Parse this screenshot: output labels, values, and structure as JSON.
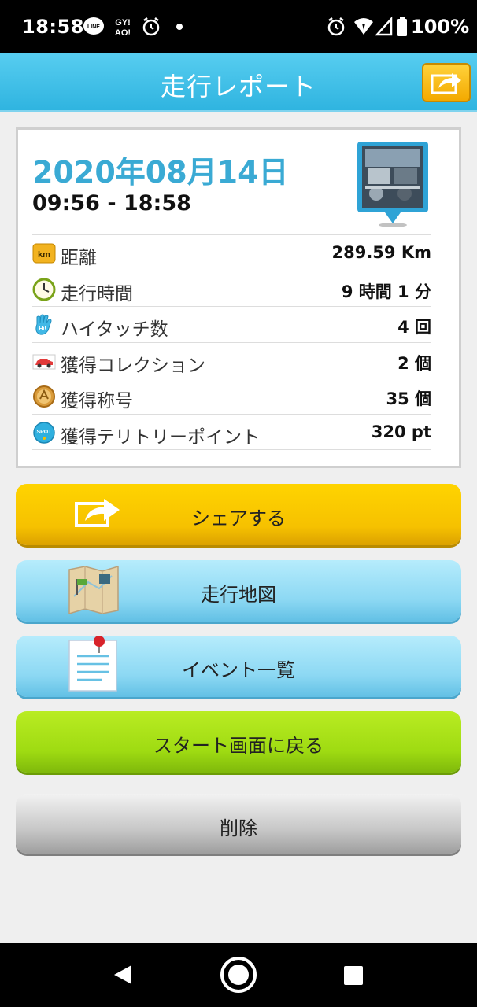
{
  "status_bar": {
    "time": "18:58",
    "battery": "100%",
    "icons": [
      "line-icon",
      "gyao-icon",
      "alarm-icon",
      "dot-icon",
      "alarm-icon",
      "wifi-icon",
      "signal-icon",
      "battery-icon"
    ]
  },
  "header": {
    "title": "走行レポート",
    "share_icon": "share-icon"
  },
  "report": {
    "date": "2020年08月14日",
    "time_range": "09:56 - 18:58",
    "stats": [
      {
        "icon": "km-icon",
        "label": "距離",
        "value": "289.59 Km"
      },
      {
        "icon": "clock-icon",
        "label": "走行時間",
        "value": "9 時間 1 分"
      },
      {
        "icon": "hand-icon",
        "label": "ハイタッチ数",
        "value": "4 回"
      },
      {
        "icon": "car-icon",
        "label": "獲得コレクション",
        "value": "2 個"
      },
      {
        "icon": "medal-icon",
        "label": "獲得称号",
        "value": "35 個"
      },
      {
        "icon": "spot-icon",
        "label": "獲得テリトリーポイント",
        "value": "320 pt"
      }
    ]
  },
  "buttons": {
    "share": "シェアする",
    "map": "走行地図",
    "events": "イベント一覧",
    "start": "スタート画面に戻る",
    "delete": "削除"
  },
  "colors": {
    "header": "#2fb4e0",
    "date": "#3aaad4",
    "share_button": "#f6c100",
    "blue_button": "#8cd8f3",
    "green_button": "#9fdb12",
    "gray_button": "#c7c7c7"
  }
}
